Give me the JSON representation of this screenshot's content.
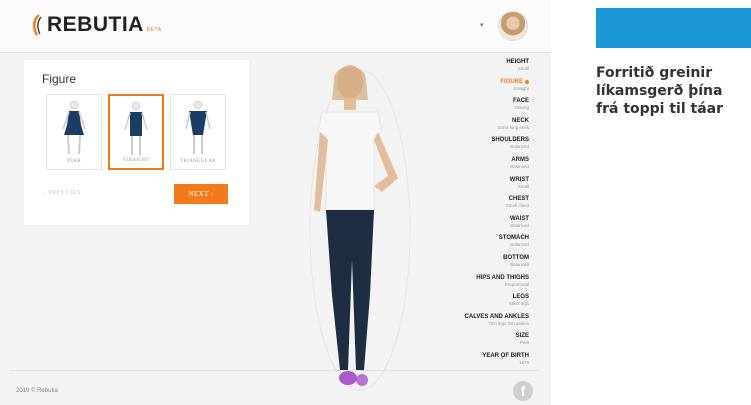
{
  "app": {
    "logo_text": "REBUTIA",
    "logo_badge": "BETA",
    "dropdown_icon": "chevron-down-icon",
    "colors": {
      "accent": "#f27a1a",
      "panel_bg": "#ffffff",
      "page_bg": "#f3f3f3",
      "caption_box": "#1b98d6"
    }
  },
  "panel": {
    "title": "Figure",
    "options": [
      {
        "label": "PEAR",
        "selected": false
      },
      {
        "label": "STRAIGHT",
        "selected": true
      },
      {
        "label": "TRIANGULAR",
        "selected": false
      }
    ],
    "previous_label": "‹  PREVIOUS",
    "next_label": "NEXT  ›"
  },
  "sidebar": {
    "items": [
      {
        "name": "HEIGHT",
        "value": "Small"
      },
      {
        "name": "FIGURE",
        "value": "Straight",
        "active": true
      },
      {
        "name": "FACE",
        "value": "Oblong"
      },
      {
        "name": "NECK",
        "value": "Extra long neck"
      },
      {
        "name": "SHOULDERS",
        "value": "Balanced"
      },
      {
        "name": "ARMS",
        "value": "Balanced"
      },
      {
        "name": "WRIST",
        "value": "Small"
      },
      {
        "name": "CHEST",
        "value": "Small chest"
      },
      {
        "name": "WAIST",
        "value": "Balanced"
      },
      {
        "name": "STOMACH",
        "value": "Balanced"
      },
      {
        "name": "BOTTOM",
        "value": "Balanced"
      },
      {
        "name": "HIPS AND THIGHS",
        "value": "Proportional"
      },
      {
        "name": "LEGS",
        "value": "Short legs"
      },
      {
        "name": "CALVES AND ANKLES",
        "value": "Thin legs thin ankles"
      },
      {
        "name": "SIZE",
        "value": "Petit"
      },
      {
        "name": "YEAR OF BIRTH",
        "value": "1979"
      }
    ]
  },
  "footer": {
    "copyright": "2019 © Rebutia",
    "social_icon": "facebook-icon",
    "social_glyph": "f"
  },
  "caption": {
    "text": "Forritið greinir\nlíkamsgerð þína\nfrá toppi til táar"
  }
}
